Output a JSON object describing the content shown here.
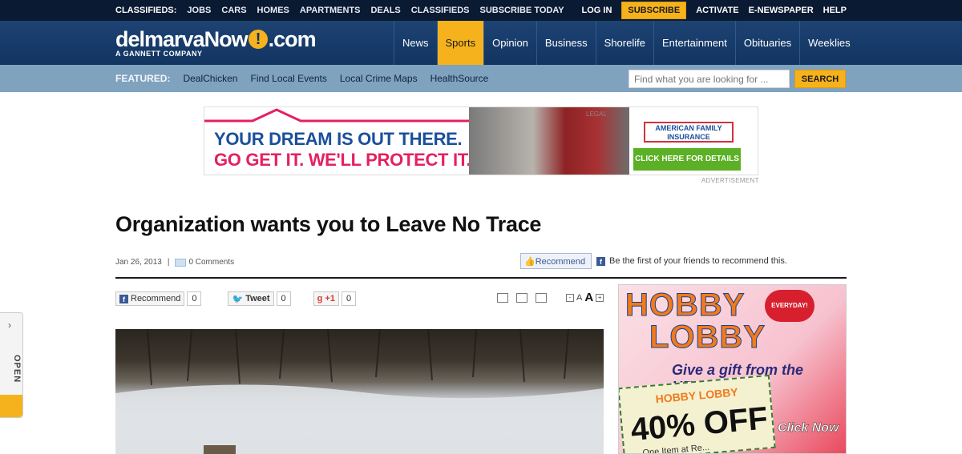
{
  "topbar": {
    "classifieds_label": "CLASSIFIEDS:",
    "links": [
      "JOBS",
      "CARS",
      "HOMES",
      "APARTMENTS",
      "DEALS",
      "CLASSIFIEDS",
      "SUBSCRIBE TODAY"
    ],
    "login": "LOG IN",
    "subscribe": "SUBSCRIBE",
    "activate": "ACTIVATE",
    "enewspaper": "E-NEWSPAPER",
    "help": "HELP"
  },
  "header": {
    "logo_left": "delmarva",
    "logo_now": "Now",
    "logo_bang": "!",
    "logo_right": ".com",
    "logo_tag": "A GANNETT COMPANY",
    "nav": [
      "News",
      "Sports",
      "Opinion",
      "Business",
      "Shorelife",
      "Entertainment",
      "Obituaries",
      "Weeklies"
    ],
    "active_nav": "Sports"
  },
  "featured": {
    "label": "FEATURED:",
    "links": [
      "DealChicken",
      "Find Local Events",
      "Local Crime Maps",
      "HealthSource"
    ],
    "search_placeholder": "Find what you are looking for ...",
    "search_button": "SEARCH"
  },
  "top_ad": {
    "line1": "YOUR DREAM IS OUT THERE.",
    "line2": "GO GET IT. WE'LL PROTECT IT.",
    "legal": "LEGAL",
    "brand": "AMERICAN FAMILY INSURANCE",
    "cta": "CLICK HERE FOR DETAILS ▸",
    "label": "ADVERTISEMENT"
  },
  "article": {
    "title": "Organization wants you to Leave No Trace",
    "date": "Jan 26, 2013",
    "separator": "|",
    "comments": "0 Comments",
    "fb_recommend": "Recommend",
    "fb_text": "Be the first of your friends to recommend this."
  },
  "share": {
    "recommend": "Recommend",
    "recommend_count": "0",
    "tweet": "Tweet",
    "tweet_count": "0",
    "plusone": "+1",
    "plusone_count": "0"
  },
  "font_size": {
    "minus": "-",
    "small": "A",
    "large": "A",
    "plus": "+"
  },
  "side_ad": {
    "line1": "HOBBY",
    "line2": "LOBBY",
    "badge": "EVERYDAY!",
    "gift": "Give a gift from the HEART.",
    "coupon_brand": "HOBBY LOBBY",
    "coupon_offer": "40% OFF",
    "coupon_sub": "One Item at Re...",
    "click": "Click Now"
  },
  "open_tab": {
    "label": "OPEN",
    "chevron": "›"
  },
  "colors": {
    "navy": "#0a1a33",
    "header_blue": "#123461",
    "accent_yellow": "#f6b21c",
    "featured_blue": "#7fa2bf"
  }
}
